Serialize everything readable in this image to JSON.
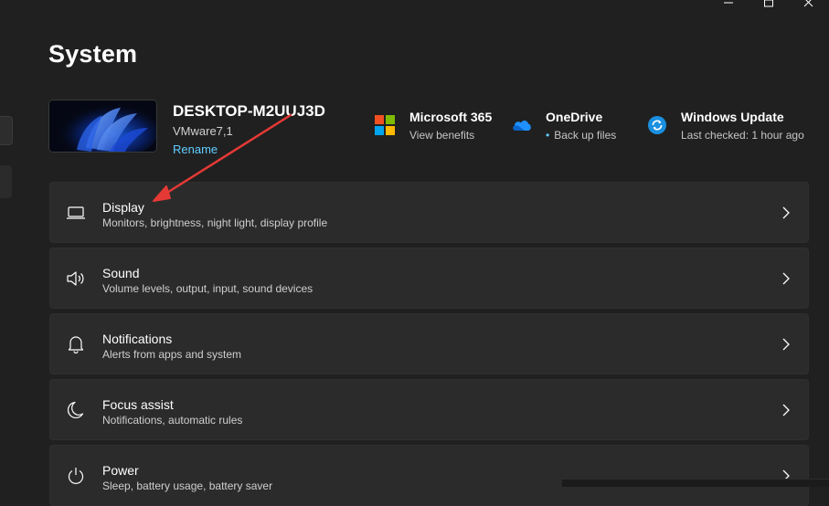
{
  "page": {
    "title": "System"
  },
  "device": {
    "name": "DESKTOP-M2UUJ3D",
    "model": "VMware7,1",
    "rename_label": "Rename"
  },
  "quick_links": [
    {
      "title": "Microsoft 365",
      "subtitle": "View benefits",
      "icon": "microsoft-365-icon"
    },
    {
      "title": "OneDrive",
      "subtitle": "Back up files",
      "icon": "onedrive-icon",
      "status_dot": "•"
    },
    {
      "title": "Windows Update",
      "subtitle": "Last checked: 1 hour ago",
      "icon": "windows-update-icon"
    }
  ],
  "settings": [
    {
      "title": "Display",
      "subtitle": "Monitors, brightness, night light, display profile",
      "icon": "display-icon"
    },
    {
      "title": "Sound",
      "subtitle": "Volume levels, output, input, sound devices",
      "icon": "sound-icon"
    },
    {
      "title": "Notifications",
      "subtitle": "Alerts from apps and system",
      "icon": "bell-icon"
    },
    {
      "title": "Focus assist",
      "subtitle": "Notifications, automatic rules",
      "icon": "moon-icon"
    },
    {
      "title": "Power",
      "subtitle": "Sleep, battery usage, battery saver",
      "icon": "power-icon"
    }
  ],
  "colors": {
    "background": "#202020",
    "card": "#2b2b2b",
    "accent": "#60cdff",
    "annotation_arrow": "#e53935"
  }
}
